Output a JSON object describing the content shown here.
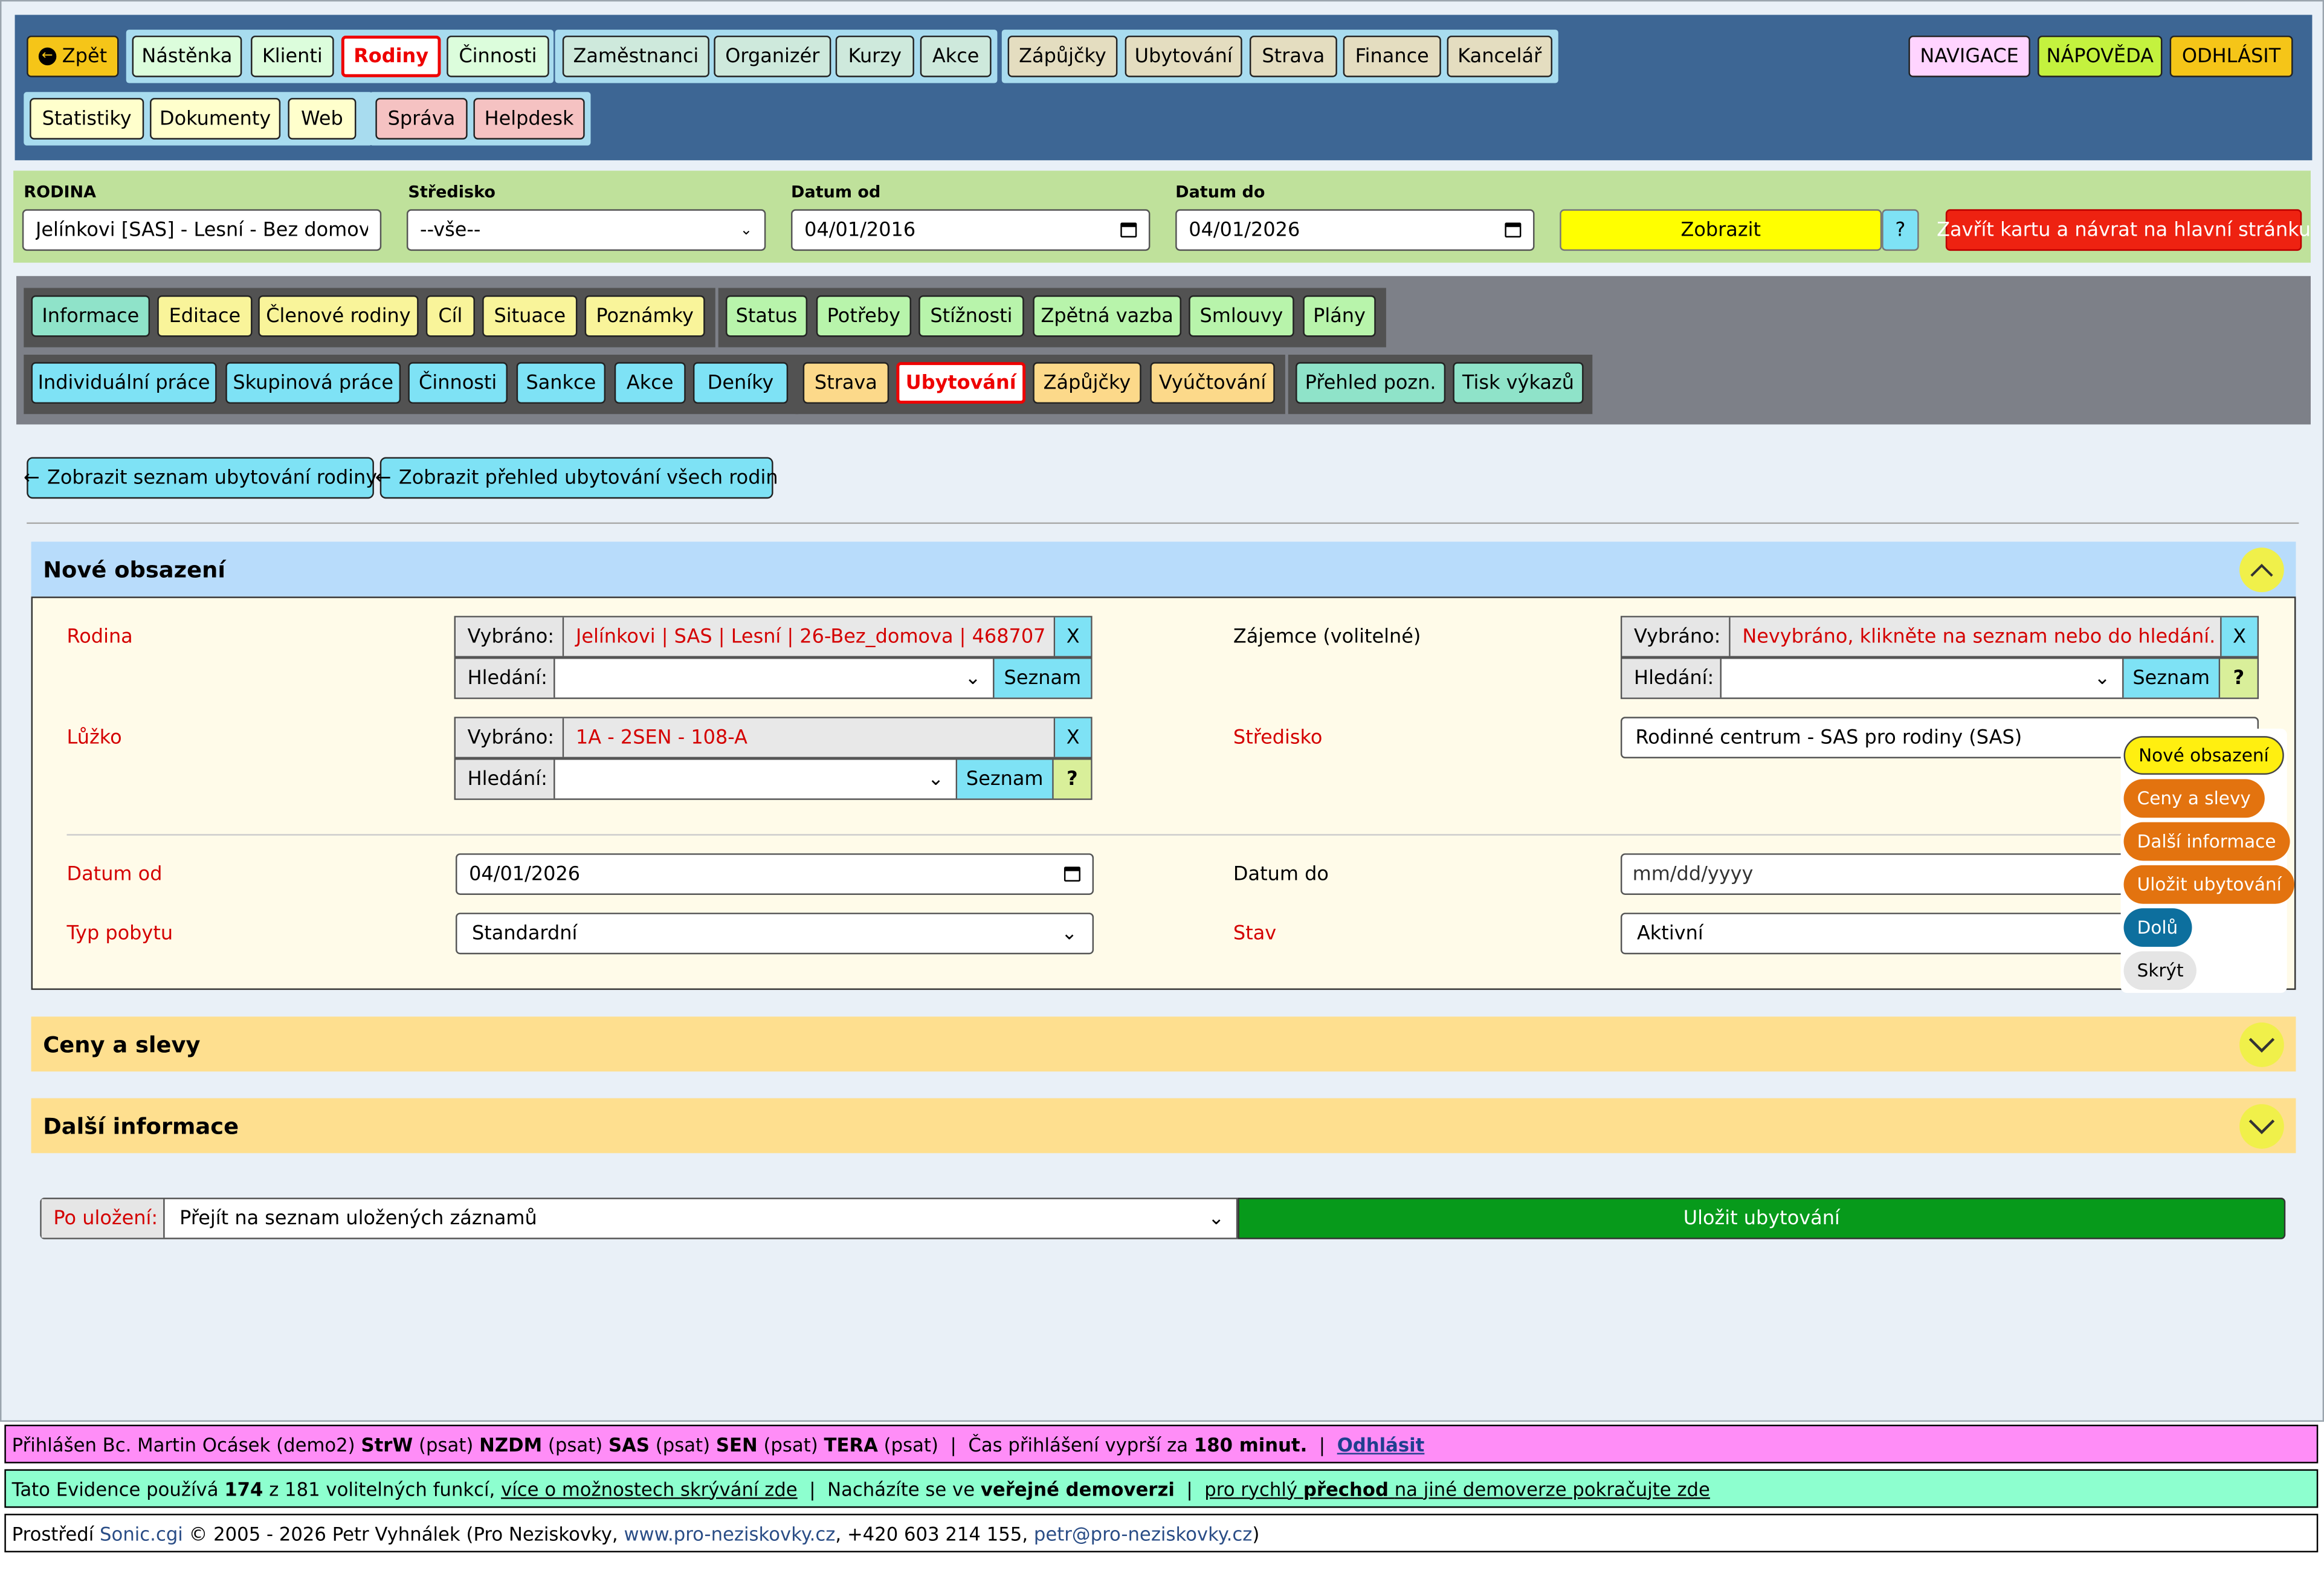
{
  "topnav": {
    "back": "Zpět",
    "group1": [
      "Nástěnka",
      "Klienti",
      "Rodiny",
      "Činnosti"
    ],
    "group2": [
      "Zaměstnanci",
      "Organizér",
      "Kurzy",
      "Akce"
    ],
    "group3": [
      "Zápůjčky",
      "Ubytování",
      "Strava",
      "Finance",
      "Kancelář"
    ],
    "group4": [
      "Statistiky",
      "Dokumenty",
      "Web"
    ],
    "group5": [
      "Správa",
      "Helpdesk"
    ],
    "right": [
      "NAVIGACE",
      "NÁPOVĚDA",
      "ODHLÁSIT"
    ]
  },
  "filter": {
    "rodina_label": "RODINA",
    "rodina_value": "Jelínkovi [SAS] - Lesní - Bez domova",
    "stredisko_label": "Středisko",
    "stredisko_value": "--vše--",
    "datum_od_label": "Datum od",
    "datum_od_value": "04/01/2016",
    "datum_do_label": "Datum do",
    "datum_do_value": "04/01/2026",
    "show": "Zobrazit",
    "help": "?",
    "close": "Zavřít kartu a návrat na hlavní stránku"
  },
  "tabs": {
    "row1a": [
      "Informace",
      "Editace",
      "Členové rodiny",
      "Cíl",
      "Situace",
      "Poznámky"
    ],
    "row1b": [
      "Status",
      "Potřeby",
      "Stížnosti",
      "Zpětná vazba",
      "Smlouvy",
      "Plány"
    ],
    "row2a": [
      "Individuální práce",
      "Skupinová práce",
      "Činnosti",
      "Sankce",
      "Akce",
      "Deníky"
    ],
    "row2b": [
      "Strava",
      "Ubytování",
      "Zápůjčky",
      "Vyúčtování"
    ],
    "row2c": [
      "Přehled pozn.",
      "Tisk výkazů"
    ]
  },
  "actions": {
    "list_family": "Zobrazit seznam ubytování rodiny",
    "list_all": "Zobrazit přehled ubytování všech rodin"
  },
  "panel": {
    "title": "Nové obsazení",
    "rodina_label": "Rodina",
    "vybrano": "Vybráno:",
    "hledani": "Hledání:",
    "rodina_selected": "Jelínkovi | SAS | Lesní | 26-Bez_domova | 468707",
    "x": "X",
    "seznam": "Seznam",
    "q": "?",
    "zajemce_label": "Zájemce (volitelné)",
    "zajemce_selected": "Nevybráno, klikněte na seznam nebo do hledání.",
    "luzko_label": "Lůžko",
    "luzko_selected": "1A - 2SEN - 108-A",
    "stredisko_label": "Středisko",
    "stredisko_value": "Rodinné centrum - SAS pro rodiny (SAS)",
    "datum_od_label": "Datum od",
    "datum_od_value": "04/01/2026",
    "datum_do_label": "Datum do",
    "datum_do_placeholder": "mm/dd/yyyy",
    "typ_label": "Typ pobytu",
    "typ_value": "Standardní",
    "stav_label": "Stav",
    "stav_value": "Aktivní"
  },
  "floatmenu": [
    "Nové obsazení",
    "Ceny a slevy",
    "Další informace",
    "Uložit ubytování",
    "Dolů",
    "Skrýt"
  ],
  "sections": [
    "Ceny a slevy",
    "Další informace"
  ],
  "save": {
    "after_label": "Po uložení:",
    "after_value": "Přejít na seznam uložených záznamů",
    "button": "Uložit ubytování"
  },
  "footer": {
    "l1_prefix": "Přihlášen Bc. Martin Ocásek (demo2)",
    "l1_roles": [
      [
        "StrW",
        "(psat)"
      ],
      [
        "NZDM",
        "(psat)"
      ],
      [
        "SAS",
        "(psat)"
      ],
      [
        "SEN",
        "(psat)"
      ],
      [
        "TERA",
        "(psat)"
      ]
    ],
    "l1_sep": "|",
    "l1_time_prefix": "Čas přihlášení vyprší za",
    "l1_time": "180 minut.",
    "l1_logout": "Odhlásit",
    "l2_a": "Tato Evidence používá",
    "l2_count": "174",
    "l2_b": "z 181 volitelných funkcí,",
    "l2_link": "více o možnostech skrývání zde",
    "l2_c": "Nacházíte se ve",
    "l2_demo": "veřejné demoverzi",
    "l2_link2_a": "pro rychlý",
    "l2_link2_b": "přechod",
    "l2_link2_c": "na jiné demoverze pokračujte zde",
    "l3_a": "Prostředí",
    "l3_sonic": "Sonic.cgi",
    "l3_b": "© 2005 - 2026 Petr Vyhnálek (Pro Neziskovky,",
    "l3_web": "www.pro-neziskovky.cz",
    "l3_c": ", +420 603 214 155,",
    "l3_mail": "petr@pro-neziskovky.cz",
    "l3_d": ")"
  },
  "colors": {
    "nav_bg": "#3d6694",
    "filter_bg": "#bfe19b",
    "tabs_bg": "#7d8088",
    "panel_head": "#b8dcfb",
    "section_head": "#fedf8f",
    "save_green": "#079a1b",
    "footer_pink": "#ff8df7",
    "footer_green": "#8dffcf"
  }
}
